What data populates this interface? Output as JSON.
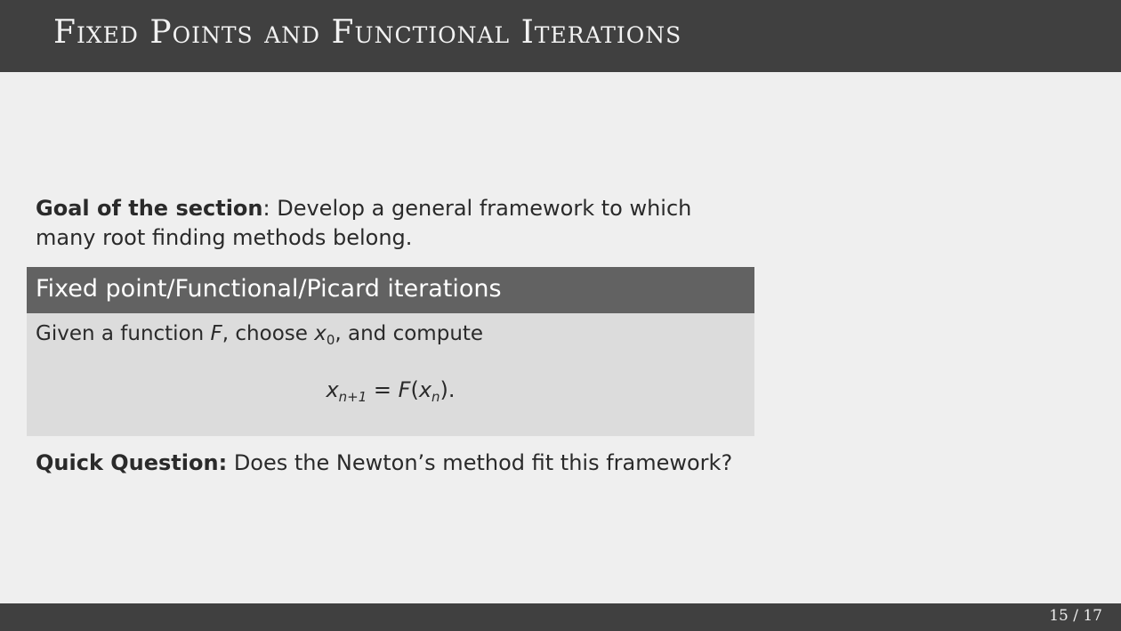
{
  "slide": {
    "title": "Fixed Points and Functional Iterations"
  },
  "goal": {
    "label": "Goal of the section",
    "text": ": Develop a general framework to which many root finding methods belong."
  },
  "block": {
    "title": "Fixed point/Functional/Picard iterations",
    "line_prefix": "Given a function ",
    "func_symbol": "F",
    "line_mid": ", choose ",
    "x_symbol": "x",
    "x0_sub": "0",
    "line_suffix": ", and compute",
    "eq_lhs_var": "x",
    "eq_lhs_sub": "n+1",
    "eq_equals": " = ",
    "eq_func": "F",
    "eq_open": "(",
    "eq_arg_var": "x",
    "eq_arg_sub": "n",
    "eq_close": ").",
    "colors": {
      "header_bg": "#626262",
      "body_bg": "#dcdcdc"
    }
  },
  "quick_question": {
    "label": "Quick Question:",
    "text": " Does the Newton’s method fit this framework?"
  },
  "footer": {
    "page": "15 / 17"
  },
  "theme": {
    "bar_color": "#404040",
    "background": "#efefef"
  }
}
